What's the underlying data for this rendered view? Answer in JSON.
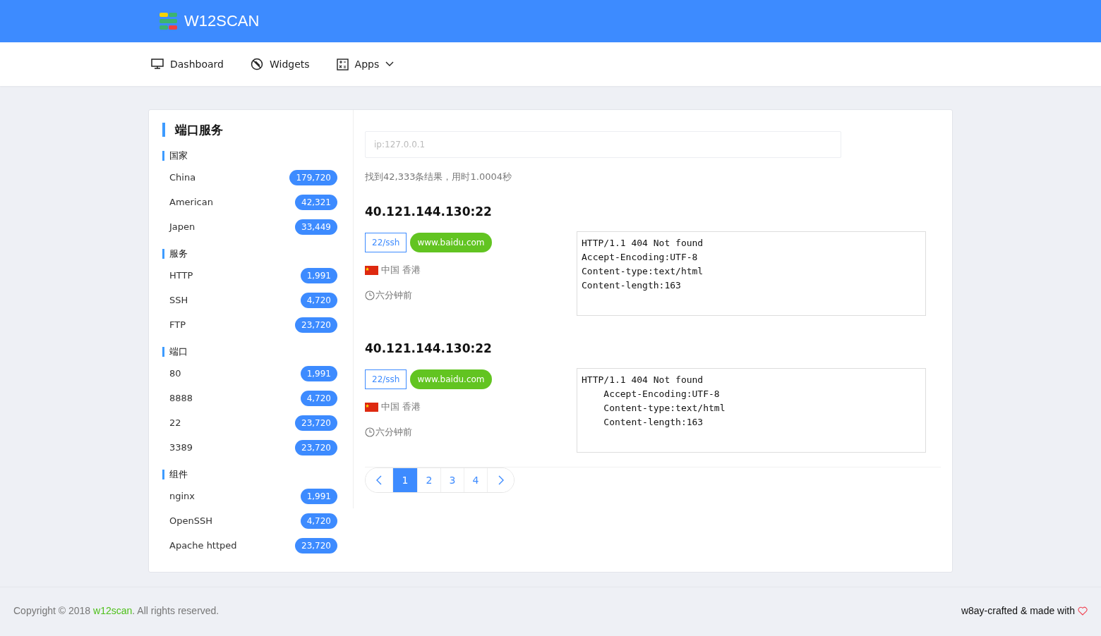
{
  "brand": {
    "name": "W12SCAN"
  },
  "nav": [
    {
      "label": "Dashboard",
      "kind": "link"
    },
    {
      "label": "Widgets",
      "kind": "link"
    },
    {
      "label": "Apps",
      "kind": "dropdown"
    }
  ],
  "sidebar": {
    "title": "端口服务",
    "sections": [
      {
        "title": "国家",
        "items": [
          {
            "label": "China",
            "count": "179,720"
          },
          {
            "label": "American",
            "count": "42,321"
          },
          {
            "label": "Japen",
            "count": "33,449"
          }
        ]
      },
      {
        "title": "服务",
        "items": [
          {
            "label": "HTTP",
            "count": "1,991"
          },
          {
            "label": "SSH",
            "count": "4,720"
          },
          {
            "label": "FTP",
            "count": "23,720"
          }
        ]
      },
      {
        "title": "端口",
        "items": [
          {
            "label": "80",
            "count": "1,991"
          },
          {
            "label": "8888",
            "count": "4,720"
          },
          {
            "label": "22",
            "count": "23,720"
          },
          {
            "label": "3389",
            "count": "23,720"
          }
        ]
      },
      {
        "title": "组件",
        "items": [
          {
            "label": "nginx",
            "count": "1,991"
          },
          {
            "label": "OpenSSH",
            "count": "4,720"
          },
          {
            "label": "Apache httped",
            "count": "23,720"
          }
        ]
      }
    ]
  },
  "search": {
    "placeholder": "ip:127.0.0.1"
  },
  "summary": "找到42,333条结果，用时1.0004秒",
  "results": [
    {
      "address": "40.121.144.130:22",
      "port_tag": "22/ssh",
      "domain_tag": "www.baidu.com",
      "location": "中国 香港",
      "time": "六分钟前",
      "response": [
        "HTTP/1.1 404 Not found",
        "Accept-Encoding:UTF-8",
        "Content-type:text/html",
        "Content-length:163"
      ]
    },
    {
      "address": "40.121.144.130:22",
      "port_tag": "22/ssh",
      "domain_tag": "www.baidu.com",
      "location": "中国 香港",
      "time": "六分钟前",
      "response": [
        "HTTP/1.1 404 Not found",
        "    Accept-Encoding:UTF-8",
        "    Content-type:text/html",
        "    Content-length:163"
      ]
    }
  ],
  "pagination": [
    {
      "label": "1",
      "selected": true
    },
    {
      "label": "2",
      "selected": false
    },
    {
      "label": "3",
      "selected": false
    },
    {
      "label": "4",
      "selected": false
    }
  ],
  "footer": {
    "copyright_before": "Copyright © 2018 ",
    "copyright_link": "w12scan",
    "copyright_after": ". All rights reserved.",
    "credit": "w8ay-crafted & made with"
  }
}
